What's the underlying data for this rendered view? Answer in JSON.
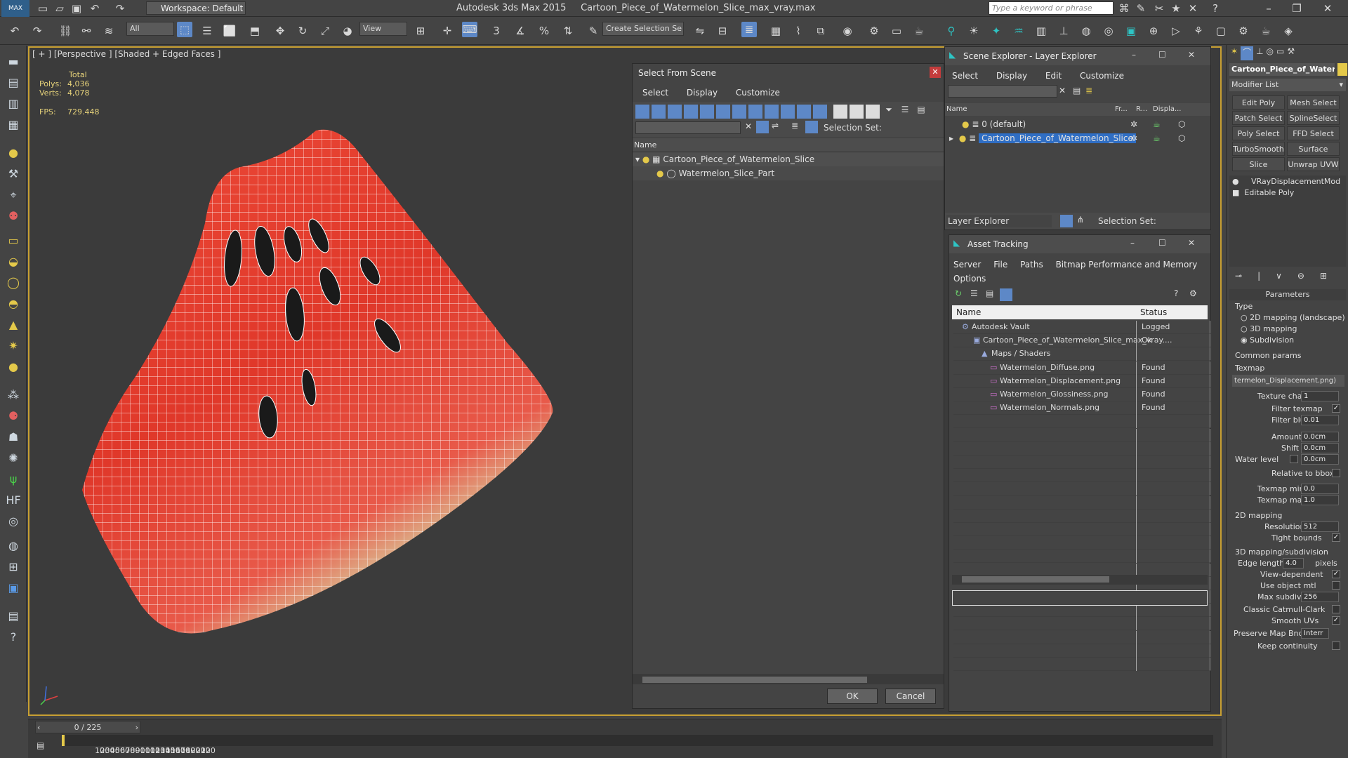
{
  "app": {
    "title": "Autodesk 3ds Max  2015",
    "file": "Cartoon_Piece_of_Watermelon_Slice_max_vray.max",
    "workspace": "Workspace: Default",
    "search_placeholder": "Type a keyword or phrase",
    "selection_filter": "All",
    "ref_coord": "View",
    "selection_set_placeholder": "Create Selection Se"
  },
  "viewport": {
    "label": "[ + ] [Perspective ] [Shaded + Edged Faces ]",
    "stats": {
      "total_label": "Total",
      "polys_label": "Polys:",
      "polys": "4,036",
      "verts_label": "Verts:",
      "verts": "4,078",
      "fps_label": "FPS:",
      "fps": "729.448"
    }
  },
  "select_from_scene": {
    "title": "Select From Scene",
    "menu": [
      "Select",
      "Display",
      "Customize"
    ],
    "selection_set_label": "Selection Set:",
    "column_name": "Name",
    "items": [
      "Cartoon_Piece_of_Watermelon_Slice",
      "Watermelon_Slice_Part"
    ],
    "ok": "OK",
    "cancel": "Cancel"
  },
  "scene_explorer": {
    "title": "Scene Explorer - Layer Explorer",
    "menu": [
      "Select",
      "Display",
      "Edit",
      "Customize"
    ],
    "columns": [
      "Name",
      "Fr...",
      "R...",
      "Displa..."
    ],
    "layers": [
      "0 (default)",
      "Cartoon_Piece_of_Watermelon_Slice"
    ],
    "footer_dropdown": "Layer Explorer",
    "selection_set_label": "Selection Set:"
  },
  "asset_tracking": {
    "title": "Asset Tracking",
    "menu": [
      "Server",
      "File",
      "Paths",
      "Bitmap Performance and Memory",
      "Options"
    ],
    "columns": [
      "Name",
      "Status"
    ],
    "rows": [
      {
        "name": "Autodesk Vault",
        "status": "Logged"
      },
      {
        "name": "Cartoon_Piece_of_Watermelon_Slice_max_vray....",
        "status": "Ok"
      },
      {
        "name": "Maps / Shaders",
        "status": ""
      },
      {
        "name": "Watermelon_Diffuse.png",
        "status": "Found"
      },
      {
        "name": "Watermelon_Displacement.png",
        "status": "Found"
      },
      {
        "name": "Watermelon_Glossiness.png",
        "status": "Found"
      },
      {
        "name": "Watermelon_Normals.png",
        "status": "Found"
      }
    ]
  },
  "command_panel": {
    "object_name": "Cartoon_Piece_of_Water",
    "modifier_list": "Modifier List",
    "modifier_buttons": [
      "Edit Poly",
      "Mesh Select",
      "Patch Select",
      "SplineSelect",
      "Poly Select",
      "FFD Select",
      "TurboSmooth",
      "Surface Select",
      "Slice",
      "Unwrap UVW"
    ],
    "stack": [
      "VRayDisplacementMod",
      "Editable Poly"
    ],
    "parameters_title": "Parameters",
    "type_label": "Type",
    "type_options": [
      "2D mapping (landscape)",
      "3D mapping",
      "Subdivision"
    ],
    "common_params": "Common params",
    "texmap_label": "Texmap",
    "texmap_value": "termelon_Displacement.png)",
    "texture_chan_label": "Texture chan",
    "texture_chan": "1",
    "filter_texmap_label": "Filter texmap",
    "filter_blur_label": "Filter blur",
    "filter_blur": "0.01",
    "amount_label": "Amount",
    "amount": "0.0cm",
    "shift_label": "Shift",
    "shift": "0.0cm",
    "water_level_label": "Water level",
    "water_level": "0.0cm",
    "relative_bbox_label": "Relative to bbox",
    "texmap_min_label": "Texmap min",
    "texmap_min": "0.0",
    "texmap_max_label": "Texmap max",
    "texmap_max": "1.0",
    "mapping2d_label": "2D mapping",
    "resolution_label": "Resolution",
    "resolution": "512",
    "tight_bounds_label": "Tight bounds",
    "mapping3d_label": "3D mapping/subdivision",
    "edge_length_label": "Edge length",
    "edge_length": "4.0",
    "pixels_label": "pixels",
    "view_dependent_label": "View-dependent",
    "use_object_mtl_label": "Use object mtl",
    "max_subdivs_label": "Max subdivs",
    "max_subdivs": "256",
    "classic_catmull_label": "Classic Catmull-Clark",
    "smooth_uvs_label": "Smooth UVs",
    "preserve_map_label": "Preserve Map Bnd",
    "preserve_map_value": "Interr",
    "keep_continuity_label": "Keep continuity"
  },
  "timeline": {
    "frame": "0 / 225",
    "ticks": [
      "10",
      "20",
      "30",
      "40",
      "50",
      "60",
      "70",
      "80",
      "90",
      "100",
      "110",
      "120",
      "130",
      "140",
      "150",
      "160",
      "170",
      "180",
      "190",
      "200",
      "210",
      "220"
    ]
  },
  "colors": {
    "accent": "#c8a032",
    "selection": "#2f6ec4",
    "watermelon": "#e2392a"
  }
}
